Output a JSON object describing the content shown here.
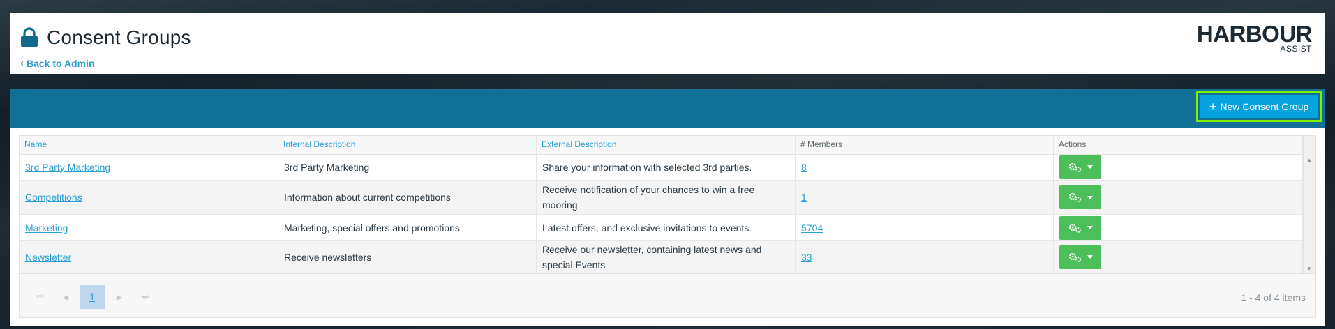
{
  "header": {
    "title": "Consent Groups",
    "back_link": "Back to Admin",
    "logo_main": "HARBOUR",
    "logo_sub": "ASSIST",
    "lock_icon": "lock-icon"
  },
  "toolbar": {
    "new_button_label": "New Consent Group",
    "plus_icon": "+"
  },
  "grid": {
    "columns": [
      "Name",
      "Internal Description",
      "External Description",
      "# Members",
      "Actions"
    ],
    "rows": [
      {
        "name": "3rd Party Marketing",
        "internal": "3rd Party Marketing",
        "external": "Share your information with selected 3rd parties.",
        "members": "8"
      },
      {
        "name": "Competitions",
        "internal": "Information about current competitions",
        "external": "Receive notification of your chances to win a free mooring",
        "members": "1"
      },
      {
        "name": "Marketing",
        "internal": "Marketing, special offers and promotions",
        "external": "Latest offers, and exclusive invitations to events.",
        "members": "5704"
      },
      {
        "name": "Newsletter",
        "internal": "Receive newsletters",
        "external": "Receive our newsletter, containing latest news and special Events",
        "members": "33"
      }
    ]
  },
  "pager": {
    "current_page": "1",
    "info": "1 - 4 of 4 items"
  },
  "colors": {
    "toolbar": "#117096",
    "primary_button": "#06a3e0",
    "highlight_outline": "#7ef000",
    "action_button": "#4cbf5a",
    "link": "#2a9fd6"
  }
}
